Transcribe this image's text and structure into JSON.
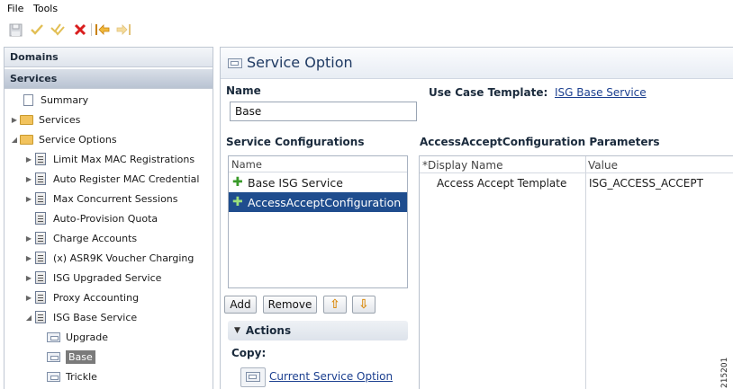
{
  "menu": {
    "items": [
      "File",
      "Tools"
    ]
  },
  "toolbar": {
    "buttons": [
      {
        "icon": "save-icon",
        "color": "#b0b4ba"
      },
      {
        "icon": "check-icon",
        "color": "#e0c060"
      },
      {
        "icon": "check-all-icon",
        "color": "#e0c060"
      },
      {
        "icon": "delete-icon",
        "color": "#d91e1e"
      },
      {
        "icon": "back-icon",
        "color": "#d9960e"
      },
      {
        "icon": "forward-icon",
        "color": "#e8c87a"
      }
    ]
  },
  "sidebar": {
    "domains_label": "Domains",
    "services_label": "Services",
    "tree": [
      {
        "label": "Summary",
        "icon": "document-icon"
      },
      {
        "label": "Services",
        "icon": "folder-icon"
      },
      {
        "label": "Service Options",
        "icon": "folder-icon"
      },
      {
        "label": "Limit Max MAC Registrations",
        "icon": "list-icon"
      },
      {
        "label": "Auto Register MAC Credential",
        "icon": "list-icon"
      },
      {
        "label": "Max Concurrent Sessions",
        "icon": "list-icon"
      },
      {
        "label": "Auto-Provision Quota",
        "icon": "list-icon"
      },
      {
        "label": "Charge Accounts",
        "icon": "list-icon"
      },
      {
        "label": "(x) ASR9K Voucher Charging",
        "icon": "list-icon"
      },
      {
        "label": "ISG Upgraded Service",
        "icon": "list-icon"
      },
      {
        "label": "Proxy Accounting",
        "icon": "list-icon"
      },
      {
        "label": "ISG Base Service",
        "icon": "list-icon"
      },
      {
        "label": "Upgrade",
        "icon": "node-icon"
      },
      {
        "label": "Base",
        "icon": "node-icon"
      },
      {
        "label": "Trickle",
        "icon": "node-icon"
      }
    ]
  },
  "editor": {
    "title": "Service Option",
    "name_label": "Name",
    "name_value": "Base",
    "use_case_label": "Use Case Template:",
    "use_case_link": "ISG Base Service",
    "configs_label": "Service Configurations",
    "configs_header": "Name",
    "configs": [
      "Base ISG Service",
      "AccessAcceptConfiguration"
    ],
    "add_label": "Add",
    "remove_label": "Remove",
    "actions_label": "Actions",
    "copy_label": "Copy:",
    "copy_link": "Current Service Option",
    "params_label": "AccessAcceptConfiguration Parameters",
    "params_headers": [
      "*Display Name",
      "Value"
    ],
    "params_rows": [
      [
        "Access Accept Template",
        "ISG_ACCESS_ACCEPT"
      ]
    ]
  },
  "figure_id": "215201"
}
